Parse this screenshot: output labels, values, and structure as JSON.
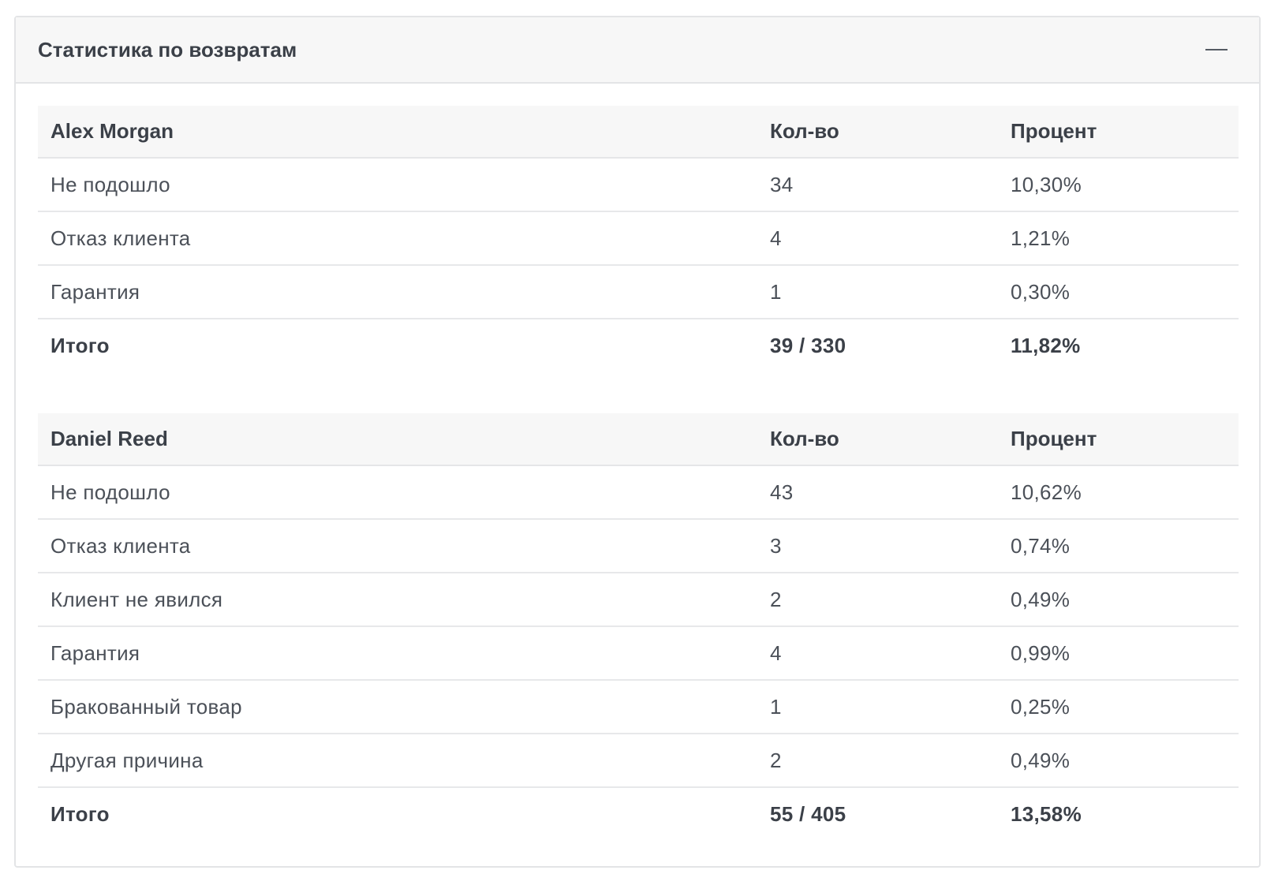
{
  "panel": {
    "title": "Статистика по возвратам",
    "collapse_icon": "minus-icon"
  },
  "tables": [
    {
      "name": "Alex Morgan",
      "col_qty": "Кол-во",
      "col_pct": "Процент",
      "rows": [
        {
          "reason": "Не подошло",
          "qty": "34",
          "pct": "10,30%"
        },
        {
          "reason": "Отказ клиента",
          "qty": "4",
          "pct": "1,21%"
        },
        {
          "reason": "Гарантия",
          "qty": "1",
          "pct": "0,30%"
        }
      ],
      "total": {
        "label": "Итого",
        "qty": "39 / 330",
        "pct": "11,82%"
      }
    },
    {
      "name": "Daniel Reed",
      "col_qty": "Кол-во",
      "col_pct": "Процент",
      "rows": [
        {
          "reason": "Не подошло",
          "qty": "43",
          "pct": "10,62%"
        },
        {
          "reason": "Отказ клиента",
          "qty": "3",
          "pct": "0,74%"
        },
        {
          "reason": "Клиент не явился",
          "qty": "2",
          "pct": "0,49%"
        },
        {
          "reason": "Гарантия",
          "qty": "4",
          "pct": "0,99%"
        },
        {
          "reason": "Бракованный товар",
          "qty": "1",
          "pct": "0,25%"
        },
        {
          "reason": "Другая причина",
          "qty": "2",
          "pct": "0,49%"
        }
      ],
      "total": {
        "label": "Итого",
        "qty": "55 / 405",
        "pct": "13,58%"
      }
    }
  ]
}
